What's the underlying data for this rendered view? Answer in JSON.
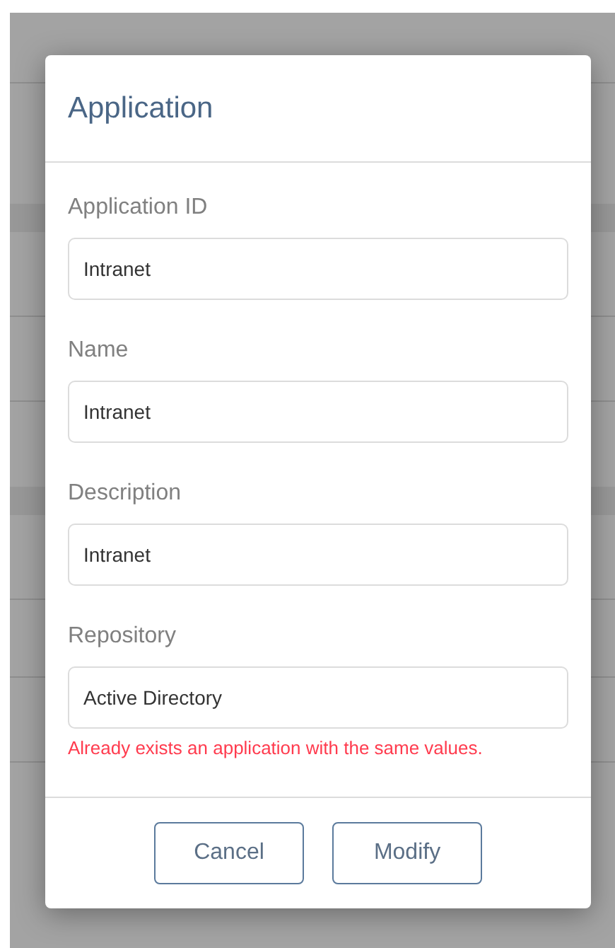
{
  "dialog": {
    "title": "Application",
    "fields": [
      {
        "label": "Application ID",
        "value": "Intranet"
      },
      {
        "label": "Name",
        "value": "Intranet"
      },
      {
        "label": "Description",
        "value": "Intranet"
      },
      {
        "label": "Repository",
        "value": "Active Directory",
        "error": "Already exists an application with the same values."
      }
    ],
    "buttons": [
      "Cancel",
      "Modify"
    ]
  }
}
